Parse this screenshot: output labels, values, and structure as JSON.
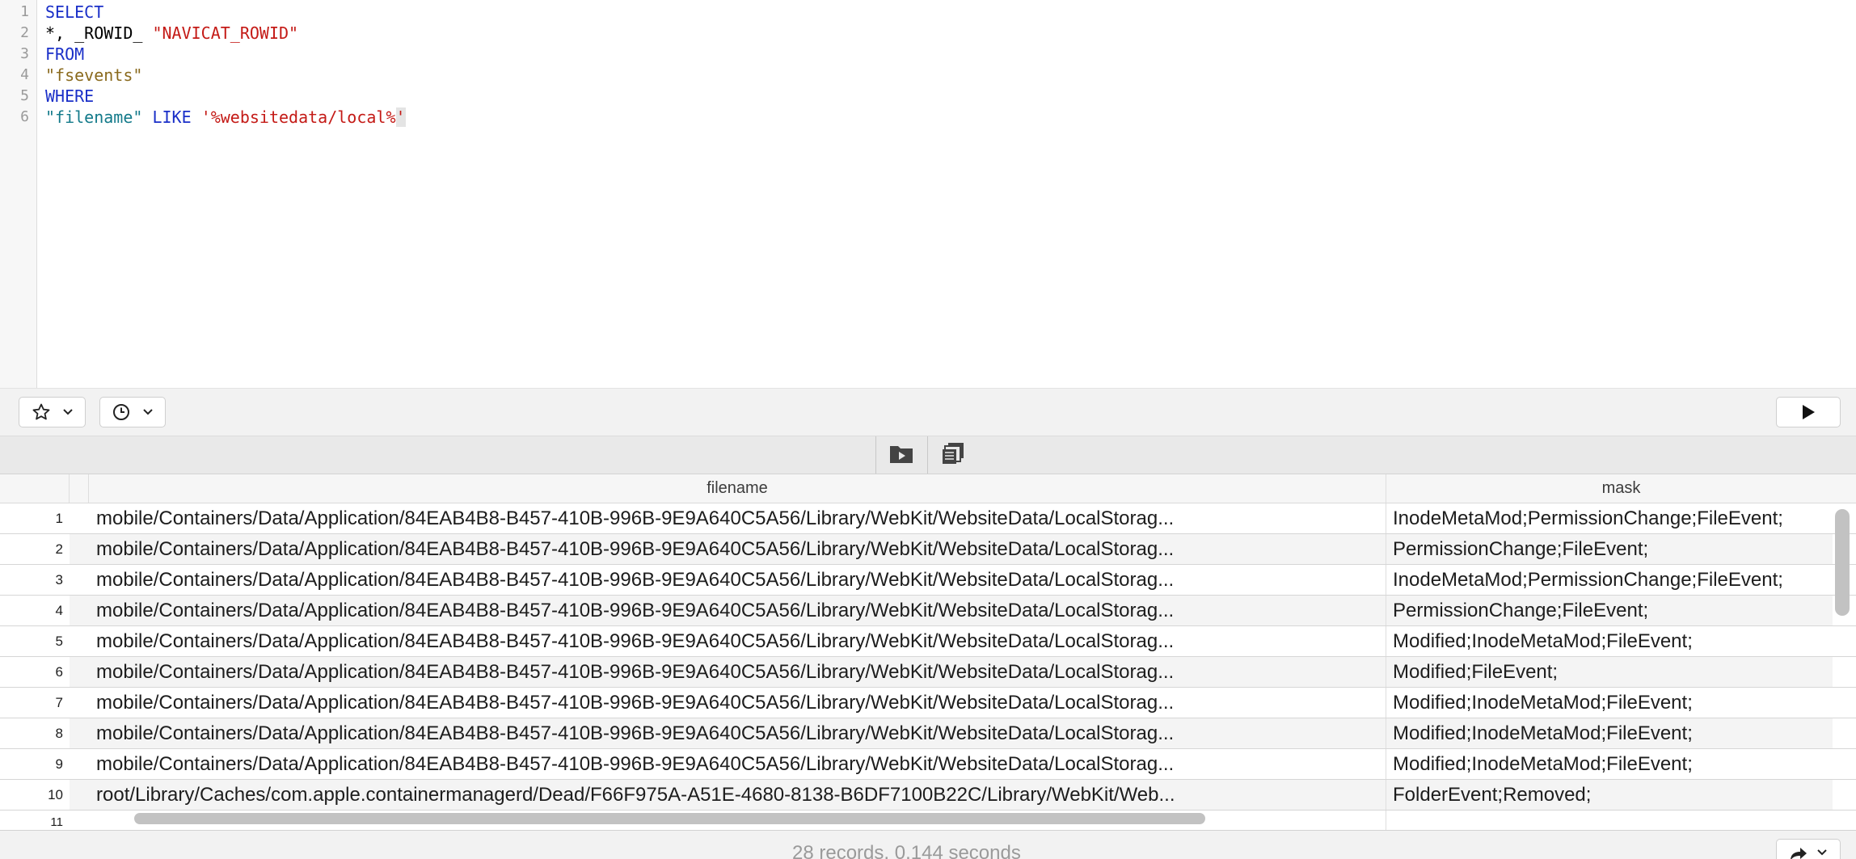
{
  "editor": {
    "line_numbers": [
      "1",
      "2",
      "3",
      "4",
      "5",
      "6"
    ],
    "lines": [
      {
        "tokens": [
          {
            "text": "SELECT",
            "kind": "kw"
          }
        ]
      },
      {
        "tokens": [
          {
            "text": "*, _ROWID_ ",
            "kind": "plain"
          },
          {
            "text": "\"NAVICAT_ROWID\"",
            "kind": "str-red"
          }
        ]
      },
      {
        "tokens": [
          {
            "text": "FROM",
            "kind": "kw"
          }
        ]
      },
      {
        "tokens": [
          {
            "text": "\"fsevents\"",
            "kind": "str-brown"
          }
        ]
      },
      {
        "tokens": [
          {
            "text": "WHERE",
            "kind": "kw"
          }
        ]
      },
      {
        "tokens": [
          {
            "text": "\"filename\"",
            "kind": "str-teal"
          },
          {
            "text": " ",
            "kind": "plain"
          },
          {
            "text": "LIKE",
            "kind": "kw"
          },
          {
            "text": " ",
            "kind": "plain"
          },
          {
            "text": "'%websitedata/local%",
            "kind": "str-red"
          },
          {
            "text": "'",
            "kind": "sel"
          }
        ]
      }
    ]
  },
  "toolbar": {
    "favorites_icon": "star-icon",
    "history_icon": "clock-icon",
    "run_icon": "play-icon"
  },
  "result_toolbar": {
    "export_icon": "folder-play-icon",
    "copy_icon": "stacked-copy-icon"
  },
  "grid": {
    "columns": [
      "filename",
      "mask"
    ],
    "rows": [
      {
        "n": "1",
        "filename": "mobile/Containers/Data/Application/84EAB4B8-B457-410B-996B-9E9A640C5A56/Library/WebKit/WebsiteData/LocalStorag...",
        "mask": "InodeMetaMod;PermissionChange;FileEvent;"
      },
      {
        "n": "2",
        "filename": "mobile/Containers/Data/Application/84EAB4B8-B457-410B-996B-9E9A640C5A56/Library/WebKit/WebsiteData/LocalStorag...",
        "mask": "PermissionChange;FileEvent;"
      },
      {
        "n": "3",
        "filename": "mobile/Containers/Data/Application/84EAB4B8-B457-410B-996B-9E9A640C5A56/Library/WebKit/WebsiteData/LocalStorag...",
        "mask": "InodeMetaMod;PermissionChange;FileEvent;"
      },
      {
        "n": "4",
        "filename": "mobile/Containers/Data/Application/84EAB4B8-B457-410B-996B-9E9A640C5A56/Library/WebKit/WebsiteData/LocalStorag...",
        "mask": "PermissionChange;FileEvent;"
      },
      {
        "n": "5",
        "filename": "mobile/Containers/Data/Application/84EAB4B8-B457-410B-996B-9E9A640C5A56/Library/WebKit/WebsiteData/LocalStorag...",
        "mask": "Modified;InodeMetaMod;FileEvent;"
      },
      {
        "n": "6",
        "filename": "mobile/Containers/Data/Application/84EAB4B8-B457-410B-996B-9E9A640C5A56/Library/WebKit/WebsiteData/LocalStorag...",
        "mask": "Modified;FileEvent;"
      },
      {
        "n": "7",
        "filename": "mobile/Containers/Data/Application/84EAB4B8-B457-410B-996B-9E9A640C5A56/Library/WebKit/WebsiteData/LocalStorag...",
        "mask": "Modified;InodeMetaMod;FileEvent;"
      },
      {
        "n": "8",
        "filename": "mobile/Containers/Data/Application/84EAB4B8-B457-410B-996B-9E9A640C5A56/Library/WebKit/WebsiteData/LocalStorag...",
        "mask": "Modified;InodeMetaMod;FileEvent;"
      },
      {
        "n": "9",
        "filename": "mobile/Containers/Data/Application/84EAB4B8-B457-410B-996B-9E9A640C5A56/Library/WebKit/WebsiteData/LocalStorag...",
        "mask": "Modified;InodeMetaMod;FileEvent;"
      },
      {
        "n": "10",
        "filename": "root/Library/Caches/com.apple.containermanagerd/Dead/F66F975A-A51E-4680-8138-B6DF7100B22C/Library/WebKit/Web...",
        "mask": "FolderEvent;Removed;"
      },
      {
        "n": "11",
        "filename": "",
        "mask": ""
      }
    ]
  },
  "status": {
    "text": "28 records, 0.144 seconds",
    "share_icon": "share-arrow-icon"
  }
}
